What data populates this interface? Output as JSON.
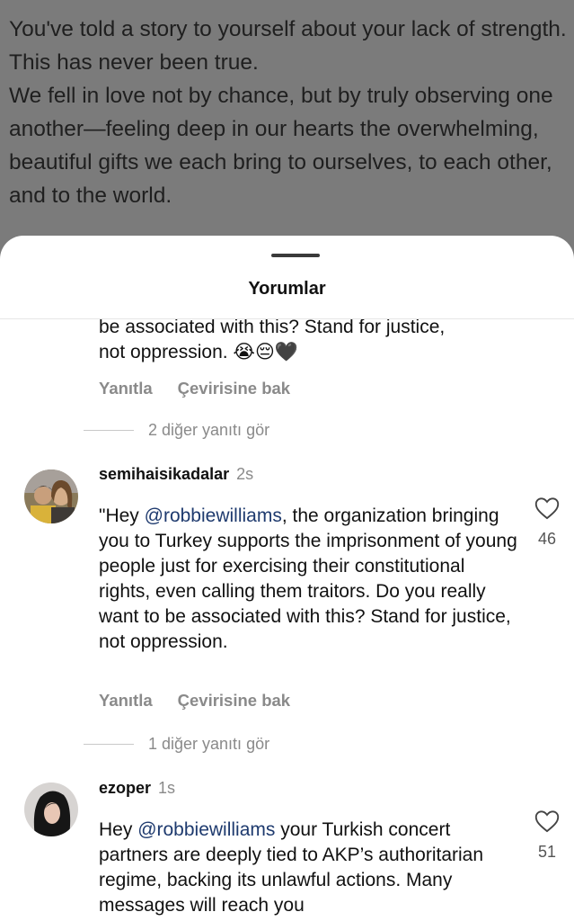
{
  "background_caption": [
    "You've told a story to yourself about your lack of strength. This has never been true.",
    "We fell in love not by chance, but by truly observing one another—feeling deep in our hearts the overwhelming, beautiful gifts we each bring to ourselves, to each other, and to the world."
  ],
  "sheet": {
    "title": "Yorumlar"
  },
  "comments": [
    {
      "text_lines": [
        "be associated with this? Stand for justice,",
        "not oppression. 😭😔🖤"
      ],
      "reply_label": "Yanıtla",
      "translate_label": "Çevirisine bak",
      "more_replies": "2 diğer yanıtı gör"
    },
    {
      "username": "semihaisikadalar",
      "time": "2s",
      "mention": "@robbiewilliams",
      "text_before_mention": "\"Hey ",
      "text_after_mention": ", the organization bringing you to Turkey supports the imprisonment of young people just for exercising their constitutional rights, even calling them traitors. Do you really want to be associated with this? Stand for justice, not oppression.",
      "likes": "46",
      "reply_label": "Yanıtla",
      "translate_label": "Çevirisine bak",
      "more_replies": "1 diğer yanıtı gör"
    },
    {
      "username": "ezoper",
      "time": "1s",
      "mention": "@robbiewilliams",
      "text_before_mention": "Hey ",
      "text_after_mention": " your Turkish concert partners are deeply tied to AKP’s authoritarian regime, backing its unlawful actions. Many messages will reach you",
      "likes": "51"
    }
  ],
  "colors": {
    "overlay": "#7b7b7b",
    "sheet": "#ffffff",
    "mention": "#1e3a6e",
    "muted": "#8a8a8a"
  }
}
